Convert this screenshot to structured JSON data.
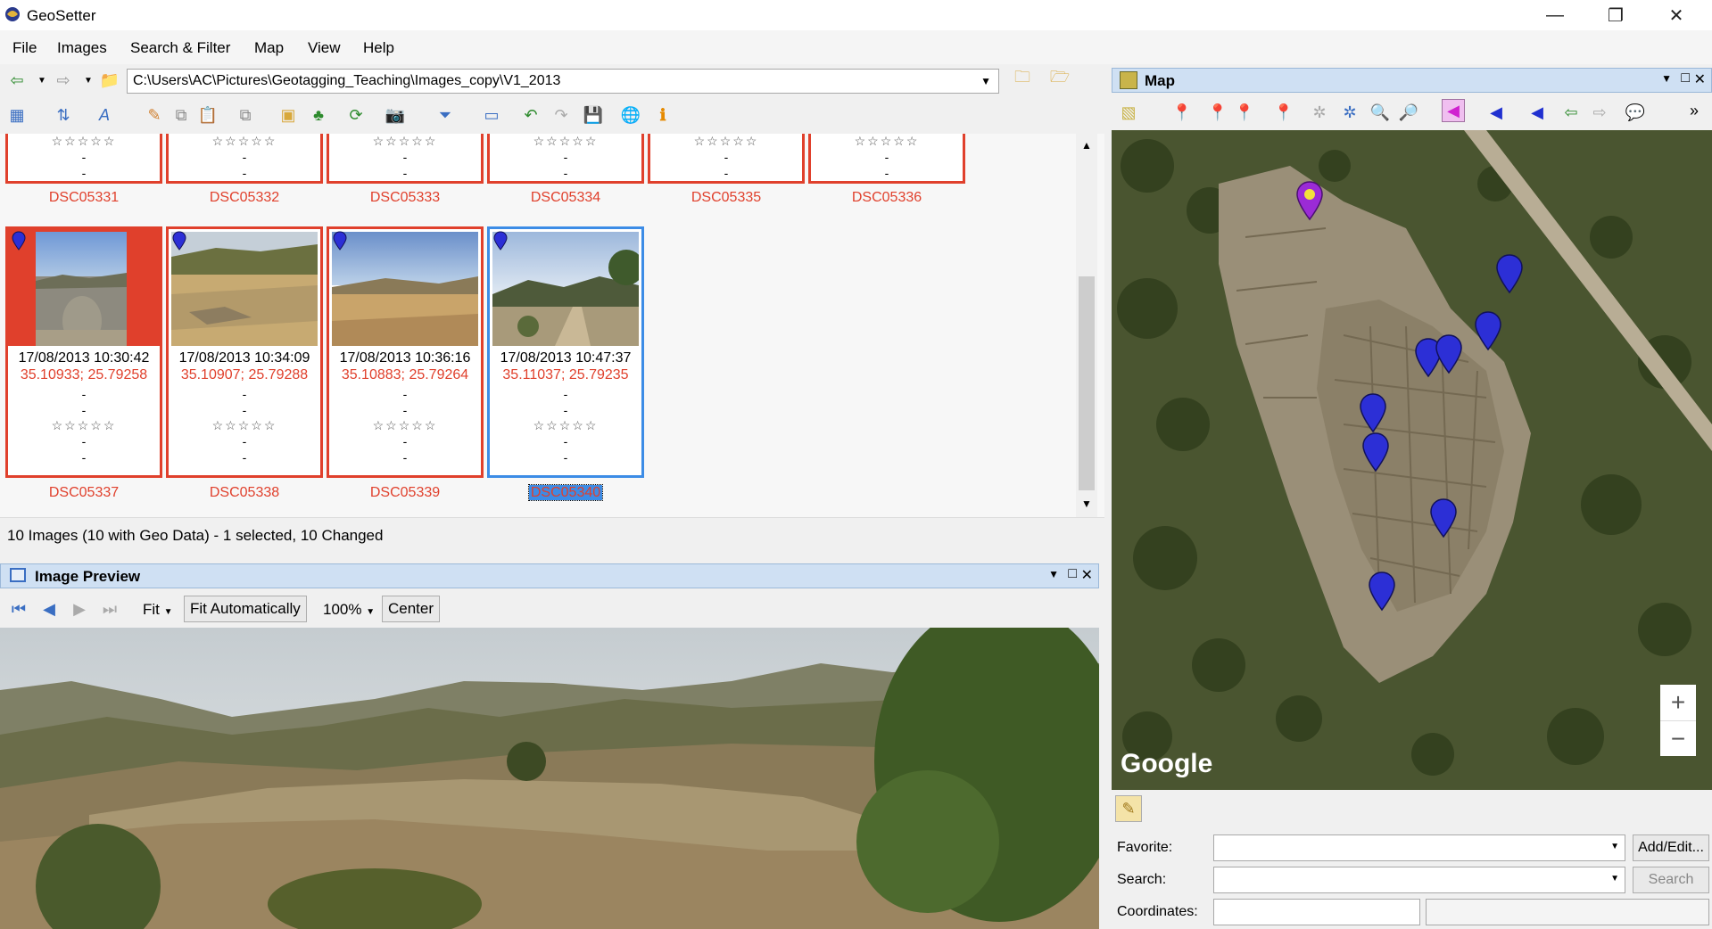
{
  "window": {
    "title": "GeoSetter"
  },
  "menu": [
    "File",
    "Images",
    "Search & Filter",
    "Map",
    "View",
    "Help"
  ],
  "address": {
    "path": "C:\\Users\\AC\\Pictures\\Geotagging_Teaching\\Images_copy\\V1_2013"
  },
  "top_row_names": [
    "DSC05331",
    "DSC05332",
    "DSC05333",
    "DSC05334",
    "DSC05335",
    "DSC05336"
  ],
  "thumbs": [
    {
      "name": "DSC05337",
      "date": "17/08/2013 10:30:42",
      "geo": "35.10933; 25.79258"
    },
    {
      "name": "DSC05338",
      "date": "17/08/2013 10:34:09",
      "geo": "35.10907; 25.79288"
    },
    {
      "name": "DSC05339",
      "date": "17/08/2013 10:36:16",
      "geo": "35.10883; 25.79264"
    },
    {
      "name": "DSC05340",
      "date": "17/08/2013 10:47:37",
      "geo": "35.11037; 25.79235"
    }
  ],
  "card_placeholder": {
    "dash": "-",
    "stars": "☆☆☆☆☆"
  },
  "status": "10 Images (10 with Geo Data) - 1 selected, 10 Changed",
  "preview": {
    "title": "Image Preview",
    "fit_label": "Fit",
    "fit_auto_label": "Fit Automatically",
    "zoom_label": "100%",
    "center_label": "Center"
  },
  "map": {
    "title": "Map",
    "google_label": "Google",
    "zoom_in": "+",
    "zoom_out": "−"
  },
  "map_form": {
    "favorite_label": "Favorite:",
    "search_label": "Search:",
    "coordinates_label": "Coordinates:",
    "add_edit_label": "Add/Edit...",
    "search_button": "Search"
  },
  "colors": {
    "accent": "#3c8ce6",
    "changed": "#e0402c",
    "panel_head": "#cfe0f3",
    "pin": "#2c2fd6",
    "pin_selected": "#9b2bd6"
  }
}
